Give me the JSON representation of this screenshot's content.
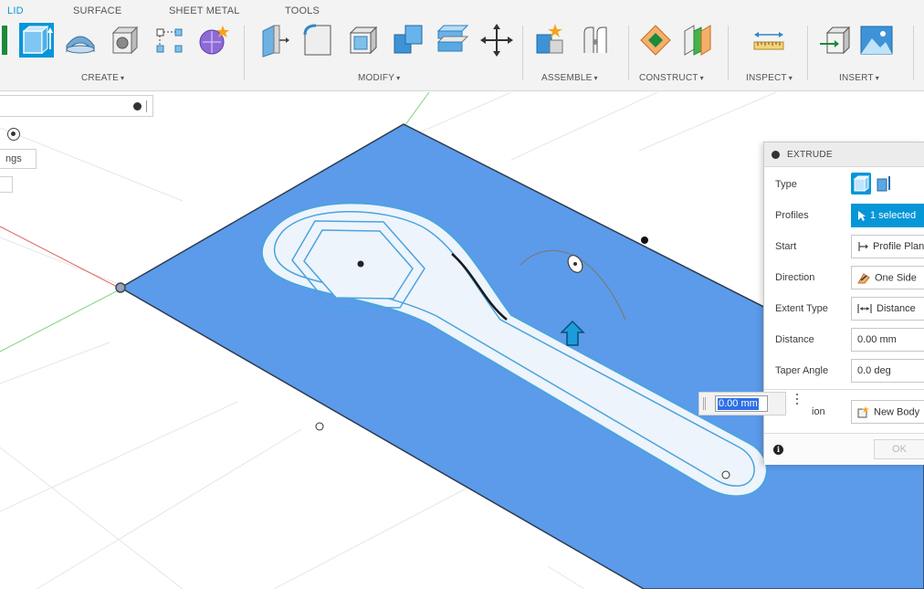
{
  "toolbar": {
    "tabs": [
      "LID",
      "SURFACE",
      "SHEET METAL",
      "TOOLS"
    ],
    "active_tab": "LID",
    "groups": {
      "create": "CREATE",
      "modify": "MODIFY",
      "assemble": "ASSEMBLE",
      "construct": "CONSTRUCT",
      "inspect": "INSPECT",
      "insert": "INSERT"
    },
    "caret": "▾"
  },
  "browser": {
    "settings_fragment": "ngs"
  },
  "extrude_dialog": {
    "title": "EXTRUDE",
    "rows": {
      "type": {
        "label": "Type"
      },
      "profiles": {
        "label": "Profiles",
        "value": "1 selected"
      },
      "start": {
        "label": "Start",
        "value": "Profile Plane"
      },
      "direction": {
        "label": "Direction",
        "value": "One Side"
      },
      "extent_type": {
        "label": "Extent Type",
        "value": "Distance"
      },
      "distance": {
        "label": "Distance",
        "value": "0.00 mm"
      },
      "taper_angle": {
        "label": "Taper Angle",
        "value": "0.0 deg"
      },
      "operation": {
        "label": "ion",
        "value": "New Body"
      }
    },
    "ok_label": "OK",
    "info_glyph": "i"
  },
  "viewport": {
    "distance_input_value": "0.00 mm"
  },
  "colors": {
    "accent": "#0696d7",
    "sketch_plane": "#5b9bea",
    "profile_fill": "#eef4fb",
    "profile_stroke": "#4aa3e0"
  }
}
